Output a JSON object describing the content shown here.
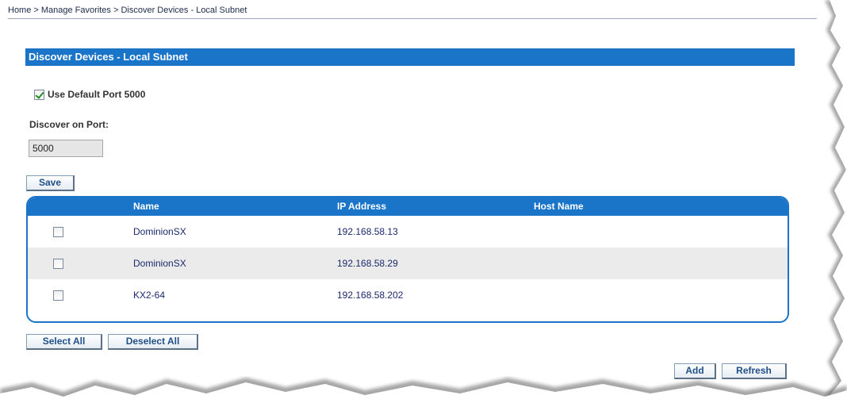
{
  "breadcrumb": "Home > Manage Favorites > Discover Devices - Local Subnet",
  "section_title": "Discover Devices - Local Subnet",
  "default_port": {
    "label": "Use Default Port 5000",
    "checked": true
  },
  "discover_port": {
    "label": "Discover on Port:",
    "value": "5000"
  },
  "buttons": {
    "save": "Save",
    "select_all": "Select All",
    "deselect_all": "Deselect All",
    "add": "Add",
    "refresh": "Refresh"
  },
  "table": {
    "columns": [
      "Name",
      "IP Address",
      "Host Name"
    ],
    "rows": [
      {
        "name": "DominionSX",
        "ip": "192.168.58.13",
        "host": ""
      },
      {
        "name": "DominionSX",
        "ip": "192.168.58.29",
        "host": ""
      },
      {
        "name": "KX2-64",
        "ip": "192.168.58.202",
        "host": ""
      }
    ]
  },
  "colors": {
    "accent": "#1a74c8",
    "row_alt": "#ebebeb"
  },
  "icons": [
    "checkbox-checked-icon",
    "checkbox-icon"
  ]
}
